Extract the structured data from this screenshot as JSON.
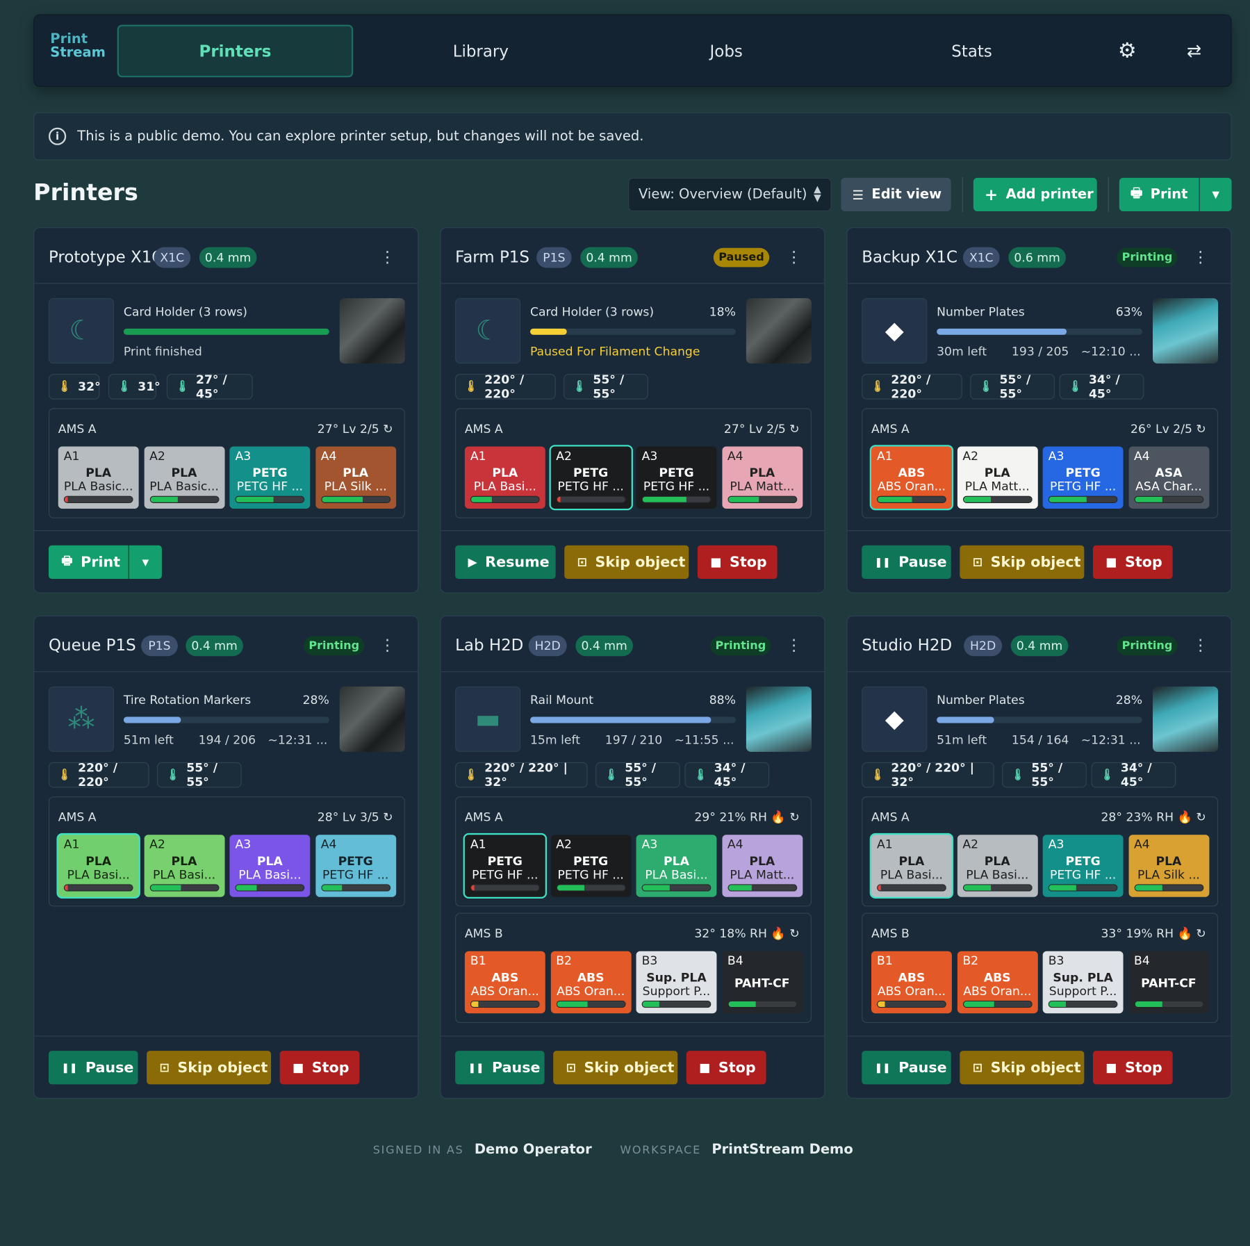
{
  "nav": {
    "logo_line1": "Print",
    "logo_line2": "Stream",
    "tabs": [
      "Printers",
      "Library",
      "Jobs",
      "Stats"
    ],
    "active_tab": "Printers"
  },
  "banner": {
    "text": "This is a public demo. You can explore printer setup, but changes will not be saved."
  },
  "header": {
    "title": "Printers",
    "view_select": "View: Overview (Default)",
    "edit_view": "Edit view",
    "add_printer": "Add printer",
    "print": "Print"
  },
  "printers": [
    {
      "name": "Prototype X1C",
      "model": "X1C",
      "nozzle": "0.4 mm",
      "status": "",
      "job": "Card Holder (3 rows)",
      "pct": "",
      "progress": 1.0,
      "sub": "Print finished",
      "temps": [
        "32°",
        "31°",
        "27° / 45°"
      ],
      "ams": [
        {
          "label": "AMS A",
          "meta": "27°  Lv 2/5  ↻",
          "slots": [
            {
              "id": "A1",
              "mat": "PLA",
              "name": "PLA Basic...",
              "level": 0.05
            },
            {
              "id": "A2",
              "mat": "PLA",
              "name": "PLA Basic...",
              "level": 0.4
            },
            {
              "id": "A3",
              "mat": "PETG",
              "name": "PETG HF ...",
              "level": 0.55
            },
            {
              "id": "A4",
              "mat": "PLA",
              "name": "PLA Silk ...",
              "level": 0.6
            }
          ]
        }
      ],
      "actions": [
        "Print"
      ]
    },
    {
      "name": "Farm P1S",
      "model": "P1S",
      "nozzle": "0.4 mm",
      "status": "Paused",
      "job": "Card Holder (3 rows)",
      "pct": "18%",
      "progress": 0.18,
      "sub": "Paused For Filament Change",
      "temps": [
        "220° / 220°",
        "55° / 55°"
      ],
      "ams": [
        {
          "label": "AMS A",
          "meta": "27°  Lv 2/5  ↻",
          "slots": [
            {
              "id": "A1",
              "mat": "PLA",
              "name": "PLA Basi...",
              "level": 0.3
            },
            {
              "id": "A2",
              "mat": "PETG",
              "name": "PETG HF ...",
              "level": 0.05
            },
            {
              "id": "A3",
              "mat": "PETG",
              "name": "PETG HF ...",
              "level": 0.65
            },
            {
              "id": "A4",
              "mat": "PLA",
              "name": "PLA Matt...",
              "level": 0.45
            }
          ]
        }
      ],
      "actions": [
        "Resume",
        "Skip object",
        "Stop"
      ]
    },
    {
      "name": "Backup X1C",
      "model": "X1C",
      "nozzle": "0.6 mm",
      "status": "Printing",
      "job": "Number Plates",
      "pct": "63%",
      "progress": 0.63,
      "left": "30m left",
      "layers": "193 / 205",
      "eta": "~12:10 ...",
      "temps": [
        "220° / 220°",
        "55° / 55°",
        "34° / 45°"
      ],
      "ams": [
        {
          "label": "AMS A",
          "meta": "26°  Lv 2/5  ↻",
          "slots": [
            {
              "id": "A1",
              "mat": "ABS",
              "name": "ABS Oran...",
              "level": 0.5
            },
            {
              "id": "A2",
              "mat": "PLA",
              "name": "PLA Matt...",
              "level": 0.4
            },
            {
              "id": "A3",
              "mat": "PETG",
              "name": "PETG HF ...",
              "level": 0.55
            },
            {
              "id": "A4",
              "mat": "ASA",
              "name": "ASA Char...",
              "level": 0.4
            }
          ]
        }
      ],
      "actions": [
        "Pause",
        "Skip object",
        "Stop"
      ]
    },
    {
      "name": "Queue P1S",
      "model": "P1S",
      "nozzle": "0.4 mm",
      "status": "Printing",
      "job": "Tire Rotation Markers",
      "pct": "28%",
      "progress": 0.28,
      "left": "51m left",
      "layers": "194 / 206",
      "eta": "~12:31 ...",
      "temps": [
        "220° / 220°",
        "55° / 55°"
      ],
      "ams": [
        {
          "label": "AMS A",
          "meta": "28°  Lv 3/5  ↻",
          "slots": [
            {
              "id": "A1",
              "mat": "PLA",
              "name": "PLA Basi...",
              "level": 0.05
            },
            {
              "id": "A2",
              "mat": "PLA",
              "name": "PLA Basi...",
              "level": 0.45
            },
            {
              "id": "A3",
              "mat": "PLA",
              "name": "PLA Basi...",
              "level": 0.3
            },
            {
              "id": "A4",
              "mat": "PETG",
              "name": "PETG HF ...",
              "level": 0.3
            }
          ]
        }
      ],
      "actions": [
        "Pause",
        "Skip object",
        "Stop"
      ]
    },
    {
      "name": "Lab H2D",
      "model": "H2D",
      "nozzle": "0.4 mm",
      "status": "Printing",
      "job": "Rail Mount",
      "pct": "88%",
      "progress": 0.88,
      "left": "15m left",
      "layers": "197 / 210",
      "eta": "~11:55 ...",
      "temps": [
        "220° / 220° | 32°",
        "55° / 55°",
        "34° / 45°"
      ],
      "ams": [
        {
          "label": "AMS A",
          "meta": "29°  21% RH  🔥  ↻",
          "slots": [
            {
              "id": "A1",
              "mat": "PETG",
              "name": "PETG HF ...",
              "level": 0.05
            },
            {
              "id": "A2",
              "mat": "PETG",
              "name": "PETG HF ...",
              "level": 0.4
            },
            {
              "id": "A3",
              "mat": "PLA",
              "name": "PLA Basi...",
              "level": 0.4
            },
            {
              "id": "A4",
              "mat": "PLA",
              "name": "PLA Matt...",
              "level": 0.35
            }
          ]
        },
        {
          "label": "AMS B",
          "meta": "32°  18% RH  🔥  ↻",
          "slots": [
            {
              "id": "B1",
              "mat": "ABS",
              "name": "ABS Oran...",
              "level": 0.1
            },
            {
              "id": "B2",
              "mat": "ABS",
              "name": "ABS Oran...",
              "level": 0.45
            },
            {
              "id": "B3",
              "mat": "Sup. PLA",
              "name": "Support P...",
              "level": 0.25
            },
            {
              "id": "B4",
              "mat": "PAHT-CF",
              "name": "",
              "level": 0.4
            }
          ]
        }
      ],
      "actions": [
        "Pause",
        "Skip object",
        "Stop"
      ]
    },
    {
      "name": "Studio H2D",
      "model": "H2D",
      "nozzle": "0.4 mm",
      "status": "Printing",
      "job": "Number Plates",
      "pct": "28%",
      "progress": 0.28,
      "left": "51m left",
      "layers": "154 / 164",
      "eta": "~12:31 ...",
      "temps": [
        "220° / 220° | 32°",
        "55° / 55°",
        "34° / 45°"
      ],
      "ams": [
        {
          "label": "AMS A",
          "meta": "28°  23% RH  🔥  ↻",
          "slots": [
            {
              "id": "A1",
              "mat": "PLA",
              "name": "PLA Basi...",
              "level": 0.05
            },
            {
              "id": "A2",
              "mat": "PLA",
              "name": "PLA Basi...",
              "level": 0.4
            },
            {
              "id": "A3",
              "mat": "PETG",
              "name": "PETG HF ...",
              "level": 0.4
            },
            {
              "id": "A4",
              "mat": "PLA",
              "name": "PLA Silk ...",
              "level": 0.4
            }
          ]
        },
        {
          "label": "AMS B",
          "meta": "33°  19% RH  🔥  ↻",
          "slots": [
            {
              "id": "B1",
              "mat": "ABS",
              "name": "ABS Oran...",
              "level": 0.1
            },
            {
              "id": "B2",
              "mat": "ABS",
              "name": "ABS Oran...",
              "level": 0.45
            },
            {
              "id": "B3",
              "mat": "Sup. PLA",
              "name": "Support P...",
              "level": 0.25
            },
            {
              "id": "B4",
              "mat": "PAHT-CF",
              "name": "",
              "level": 0.4
            }
          ]
        }
      ],
      "actions": [
        "Pause",
        "Skip object",
        "Stop"
      ]
    }
  ],
  "footer": {
    "signed_in_label": "SIGNED IN AS",
    "user": "Demo Operator",
    "workspace_label": "WORKSPACE",
    "workspace": "PrintStream Demo"
  },
  "colors": {
    "accent": "#13a06e",
    "printing": "#62e48e",
    "paused": "#a98706",
    "stop": "#b01f1f"
  }
}
